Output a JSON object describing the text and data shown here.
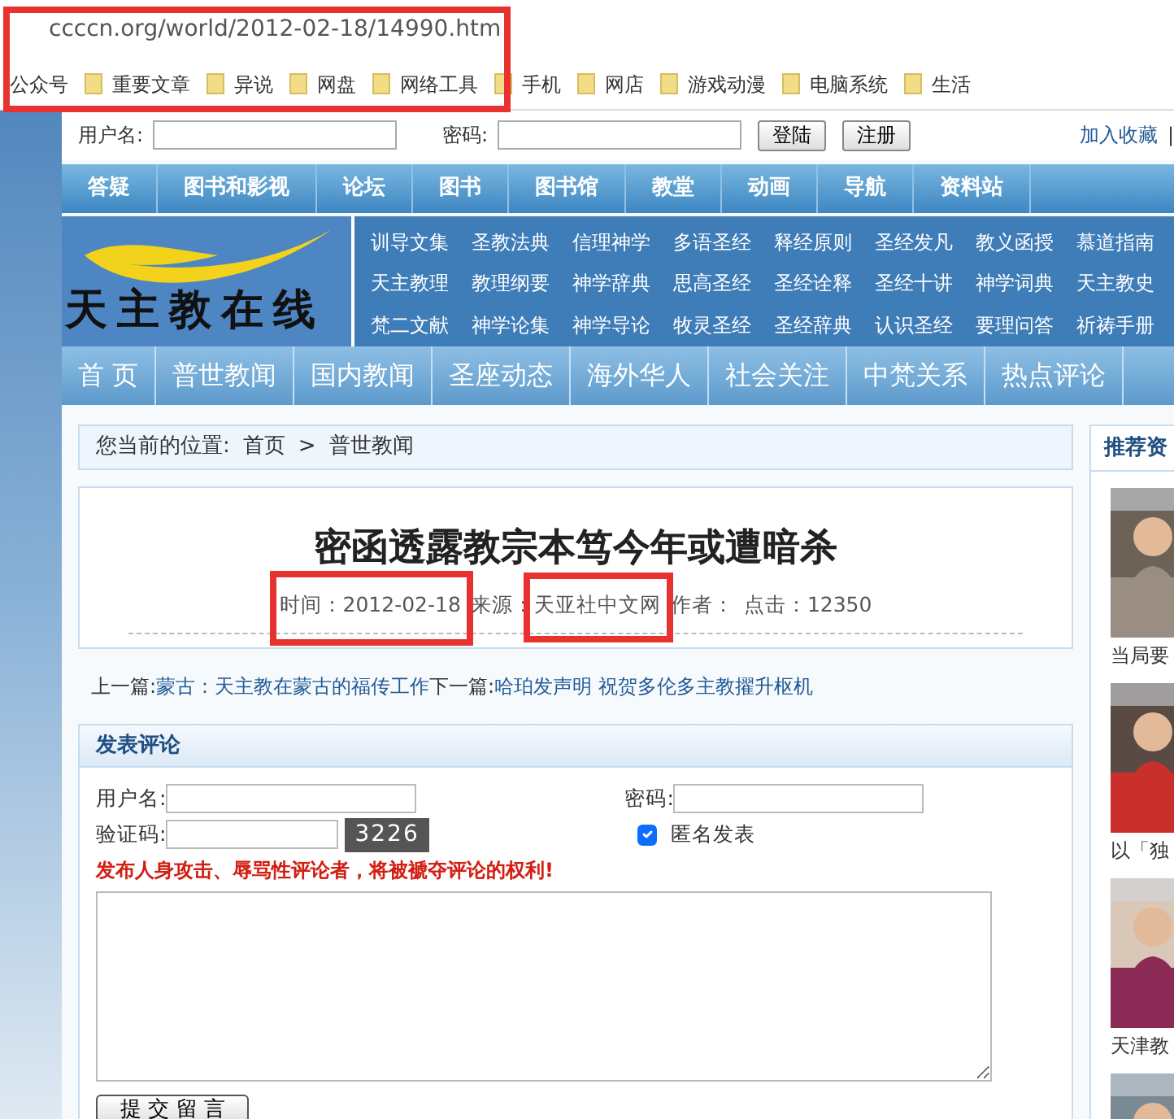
{
  "browser": {
    "address": "ccccn.org/world/2012-02-18/14990.htm",
    "bookmarks": [
      "公众号",
      "重要文章",
      "异说",
      "网盘",
      "网络工具",
      "手机",
      "网店",
      "游戏动漫",
      "电脑系统",
      "生活"
    ]
  },
  "login": {
    "username_label": "用户名:",
    "password_label": "密码:",
    "buttons": [
      "登陆",
      "注册"
    ],
    "link": "加入收藏",
    "divider": "|"
  },
  "top_nav": [
    "答疑",
    "图书和影视",
    "论坛",
    "图书",
    "图书馆",
    "教堂",
    "动画",
    "导航",
    "资料站"
  ],
  "logo": {
    "text": "天主教在线"
  },
  "sub_links": [
    "训导文集",
    "圣教法典",
    "信理神学",
    "多语圣经",
    "释经原则",
    "圣经发凡",
    "教义函授",
    "慕道指南",
    "天主教理",
    "教理纲要",
    "神学辞典",
    "思高圣经",
    "圣经诠释",
    "圣经十讲",
    "神学词典",
    "天主教史",
    "梵二文献",
    "神学论集",
    "神学导论",
    "牧灵圣经",
    "圣经辞典",
    "认识圣经",
    "要理问答",
    "祈祷手册"
  ],
  "main_nav": [
    "首 页",
    "普世教闻",
    "国内教闻",
    "圣座动态",
    "海外华人",
    "社会关注",
    "中梵关系",
    "热点评论"
  ],
  "breadcrumb": {
    "label": "您当前的位置:",
    "items": [
      "首页",
      "普世教闻"
    ],
    "separator": ">"
  },
  "article": {
    "title": "密函透露教宗本笃今年或遭暗杀",
    "time": "时间：2012-02-18",
    "source_label": "来源：",
    "source": "天亚社中文网",
    "author_label": "作者：",
    "hits": "点击：12350"
  },
  "prev_next": {
    "prev_label": "上一篇:",
    "prev": "蒙古：天主教在蒙古的福传工作",
    "next_label": "下一篇:",
    "next": "哈珀发声明 祝贺多伦多主教擢升枢机"
  },
  "comment": {
    "heading": "发表评论",
    "username_label": "用户名:",
    "password_label": "密码:",
    "captcha_label": "验证码:",
    "captcha": "3226",
    "anonymous": {
      "label": "匿名发表",
      "checked": true
    },
    "warning": "发布人身攻击、辱骂性评论者，将被褫夺评论的权利!",
    "submit": "提 交 留 言"
  },
  "sidebar": {
    "title": "推荐资",
    "items": [
      {
        "caption": "当局要",
        "kind": "picture"
      },
      {
        "caption": "以「独",
        "kind": "picture"
      },
      {
        "caption": "天津教",
        "kind": "picture"
      },
      {
        "kind": "picture"
      }
    ]
  },
  "annotations": [
    {
      "kind": "box"
    },
    {
      "kind": "box"
    },
    {
      "kind": "box"
    }
  ]
}
